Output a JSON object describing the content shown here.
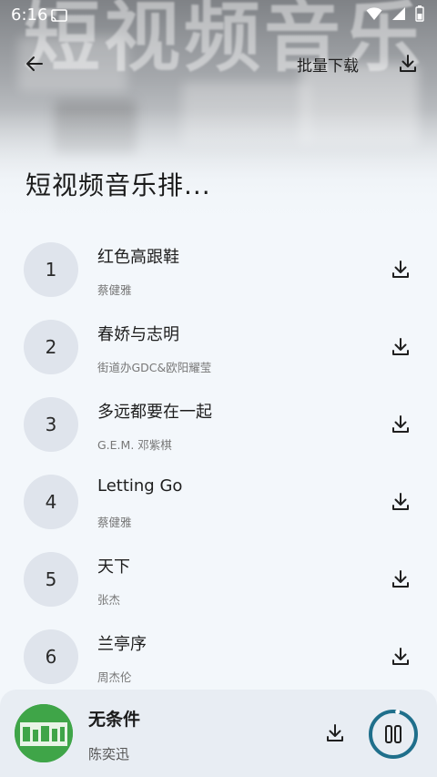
{
  "status": {
    "time": "6:16"
  },
  "header": {
    "banner_text": "短视频音乐",
    "batch_download": "批量下载",
    "title": "短视频音乐排..."
  },
  "songs": [
    {
      "index": "1",
      "title": "红色高跟鞋",
      "artist": "蔡健雅"
    },
    {
      "index": "2",
      "title": "春娇与志明",
      "artist": "街道办GDC&欧阳耀莹"
    },
    {
      "index": "3",
      "title": "多远都要在一起",
      "artist": "G.E.M. 邓紫棋"
    },
    {
      "index": "4",
      "title": "Letting Go",
      "artist": "蔡健雅"
    },
    {
      "index": "5",
      "title": "天下",
      "artist": "张杰"
    },
    {
      "index": "6",
      "title": "兰亭序",
      "artist": "周杰伦"
    }
  ],
  "player": {
    "title": "无条件",
    "artist": "陈奕迅",
    "progress": 0.03
  },
  "colors": {
    "accent": "#1f6f8b",
    "index_bg": "#dfe4ec",
    "player_bg": "#e8edf3",
    "album_green": "#3fa548"
  },
  "icons": [
    "back-arrow-icon",
    "download-icon",
    "pause-icon",
    "wifi-icon",
    "signal-icon",
    "battery-icon",
    "cast-icon"
  ]
}
